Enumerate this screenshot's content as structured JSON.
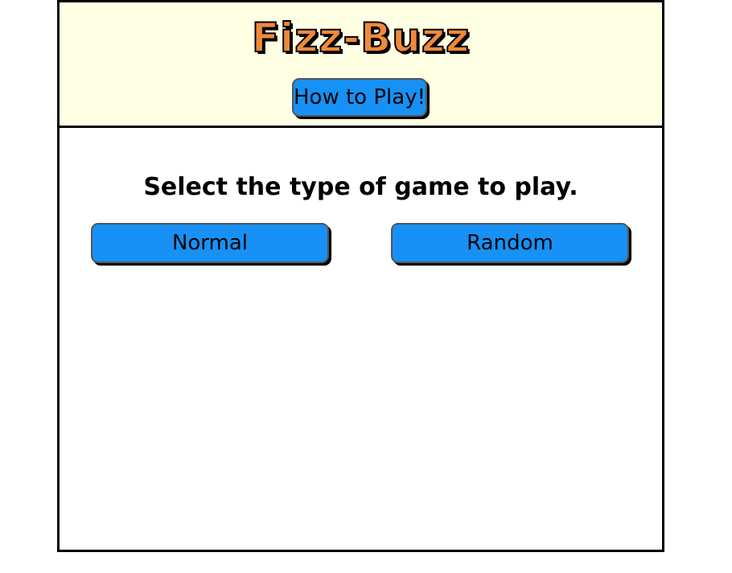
{
  "header": {
    "title": "Fizz-Buzz",
    "how_to_play_label": "How to Play!"
  },
  "main": {
    "prompt": "Select the type of game to play.",
    "buttons": [
      {
        "label": "Normal"
      },
      {
        "label": "Random"
      }
    ]
  },
  "colors": {
    "title": "#f08a3a",
    "header_background": "#ffffe3",
    "button": "#1791f5"
  }
}
